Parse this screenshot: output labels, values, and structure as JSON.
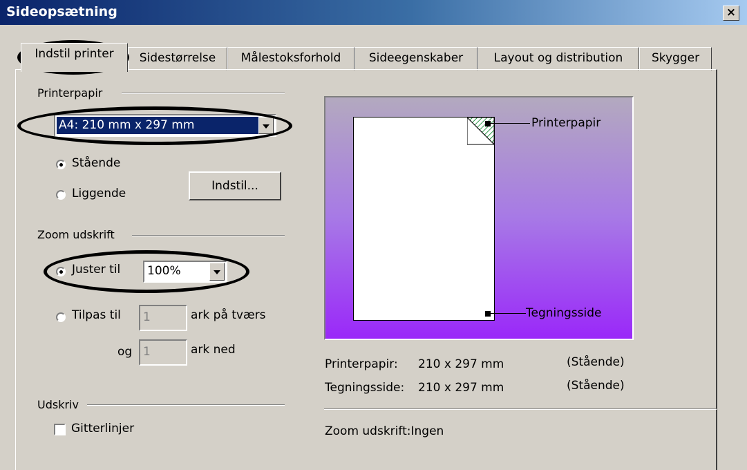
{
  "window": {
    "title": "Sideopsætning",
    "close_label": "×"
  },
  "tabs": [
    {
      "label": "Indstil printer",
      "active": true
    },
    {
      "label": "Sidestørrelse"
    },
    {
      "label": "Målestoksforhold"
    },
    {
      "label": "Sideegenskaber"
    },
    {
      "label": "Layout og distribution"
    },
    {
      "label": "Skygger"
    }
  ],
  "printer_paper": {
    "group_label": "Printerpapir",
    "size_value": "A4:  210 mm x 297 mm",
    "orientation": {
      "portrait_label": "Stående",
      "landscape_label": "Liggende",
      "selected": "portrait"
    },
    "setup_button": "Indstil..."
  },
  "zoom": {
    "group_label": "Zoom udskrift",
    "adjust_label": "Juster til",
    "adjust_value": "100%",
    "fit_label": "Tilpas til",
    "fit_across_value": "1",
    "fit_across_label": "ark på tværs",
    "og_label": "og",
    "fit_down_value": "1",
    "fit_down_label": "ark ned"
  },
  "print": {
    "group_label": "Udskriv",
    "gridlines_label": "Gitterlinjer",
    "gridlines_checked": false
  },
  "preview": {
    "paper_callout": "Printerpapir",
    "drawing_callout": "Tegningsside"
  },
  "info": {
    "paper_label": "Printerpapir:",
    "paper_value": "210 x 297 mm",
    "paper_orientation": "(Stående)",
    "drawing_label": "Tegningsside:",
    "drawing_value": "210 x 297 mm",
    "drawing_orientation": "(Stående)",
    "zoom_label": "Zoom udskrift:",
    "zoom_value": "Ingen"
  },
  "colors": {
    "title_gradient_start": "#0a246a",
    "selection": "#0a246a",
    "preview_top": "#b3a9bf",
    "preview_bottom": "#9a28f9"
  }
}
